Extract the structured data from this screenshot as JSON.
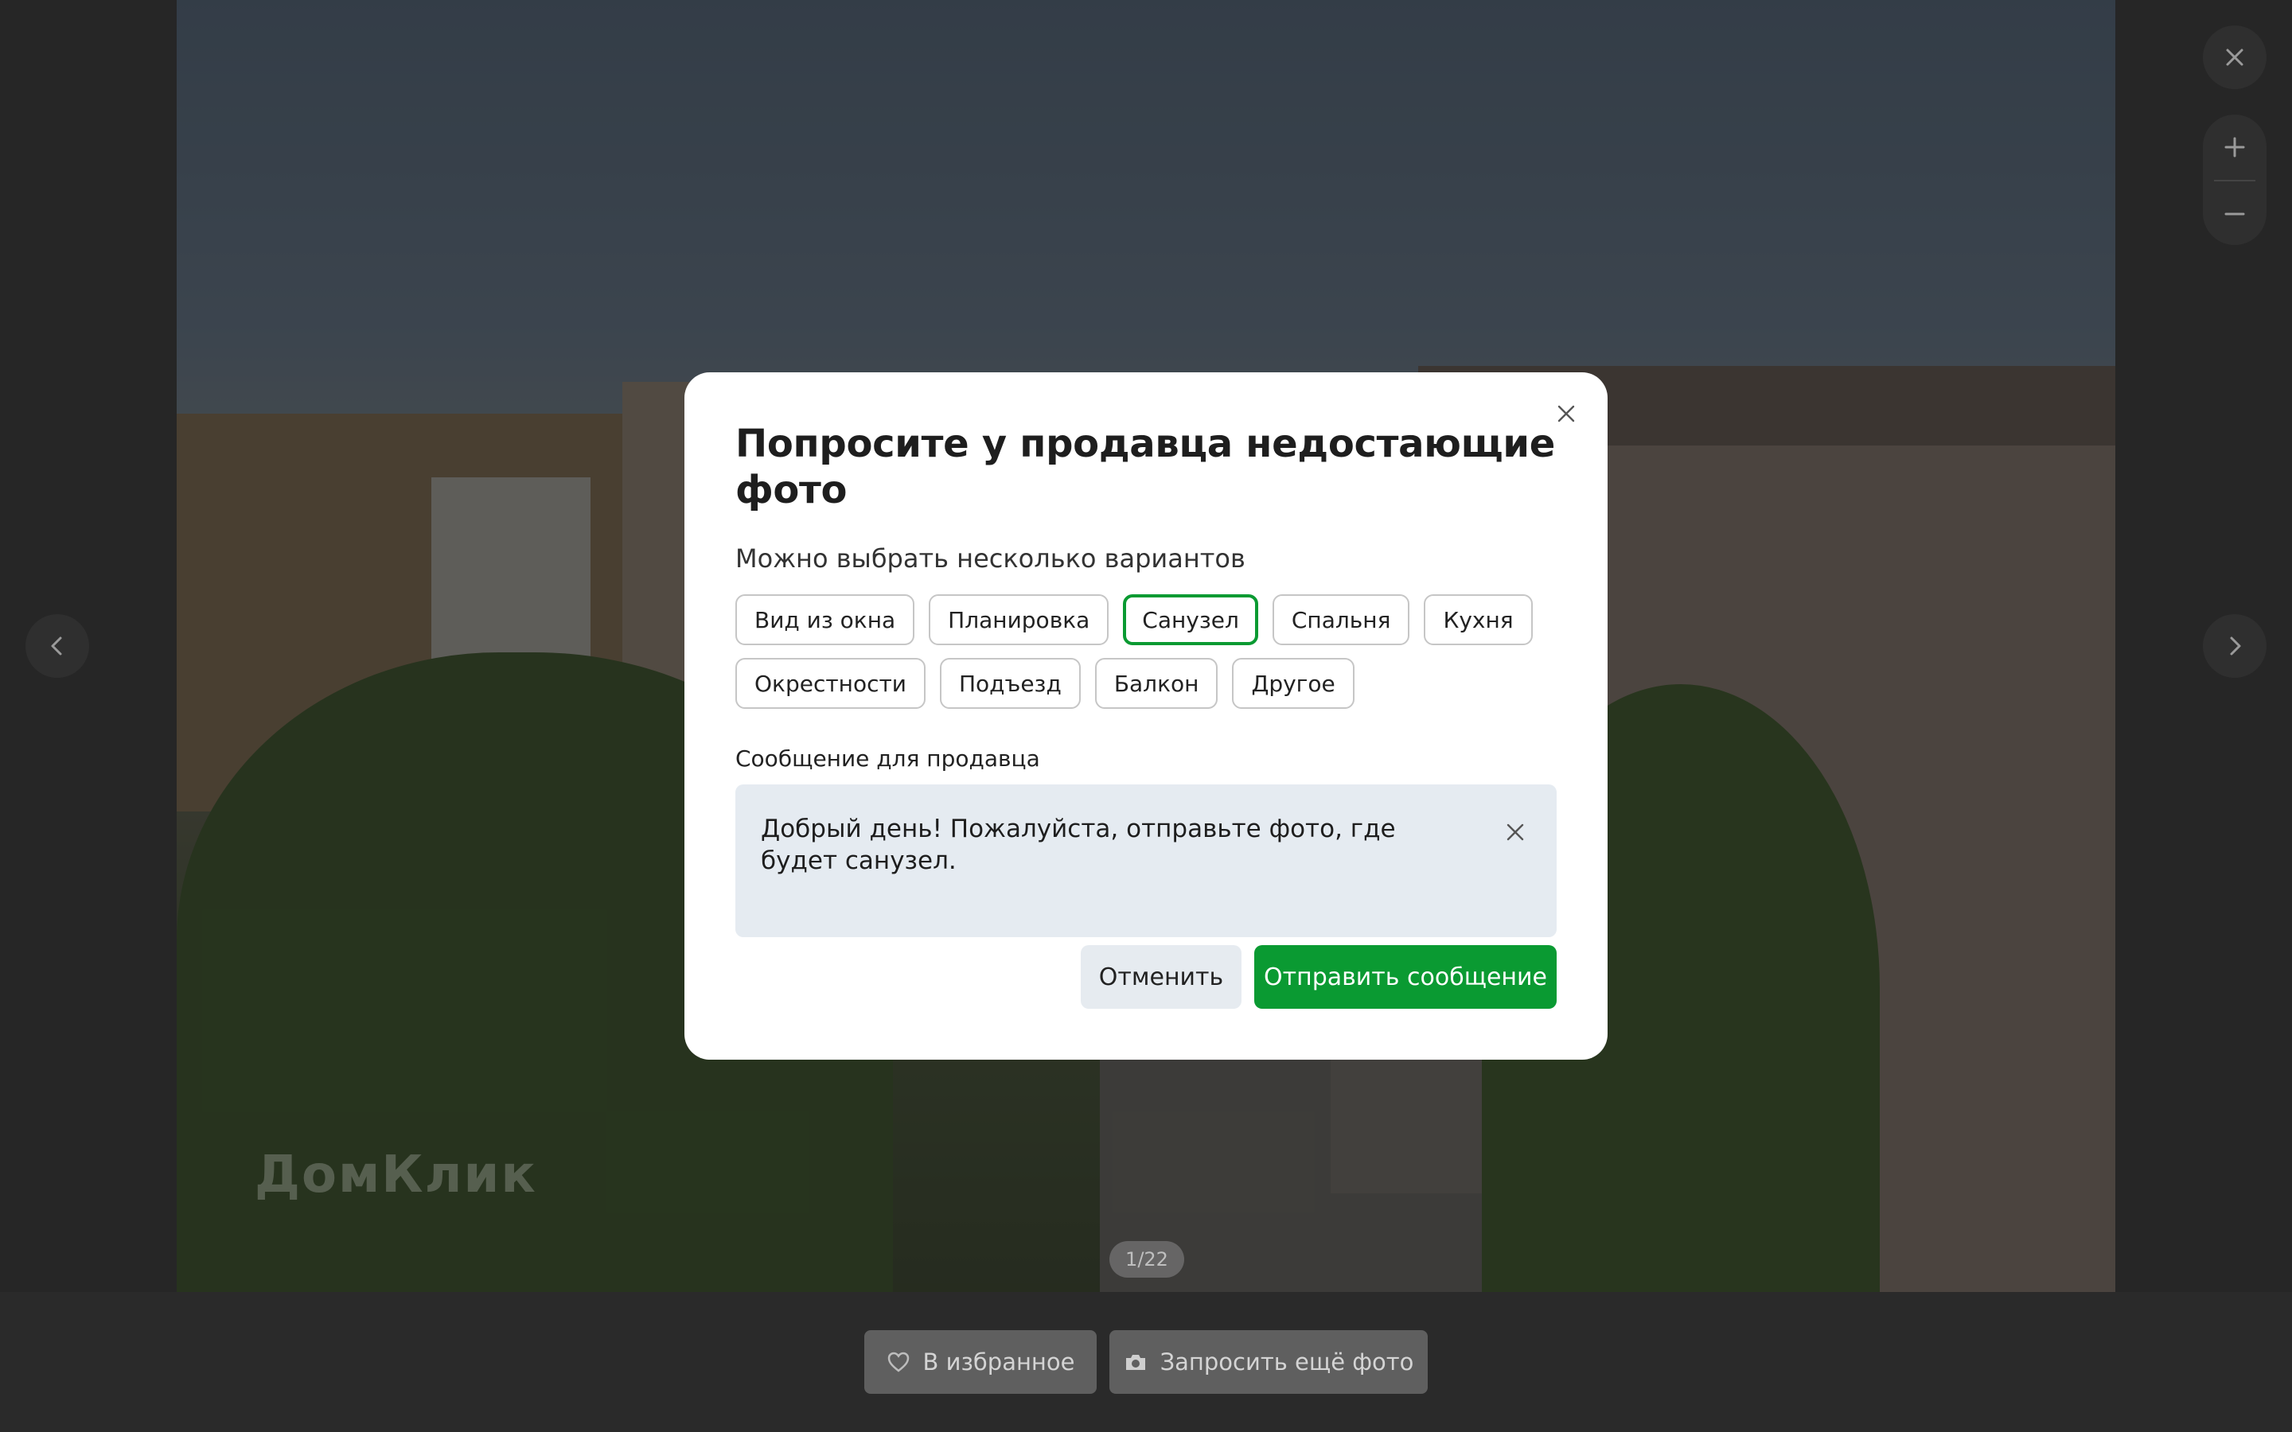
{
  "viewer": {
    "counter": "1/22",
    "watermark": "ДомКлик",
    "close_icon": "close-icon",
    "zoom_in_icon": "plus-icon",
    "zoom_out_icon": "minus-icon",
    "prev_icon": "chevron-left-icon",
    "next_icon": "chevron-right-icon"
  },
  "bottom_bar": {
    "favorite_label": "В избранное",
    "favorite_icon": "heart-icon",
    "request_label": "Запросить ещё фото",
    "request_icon": "camera-icon"
  },
  "modal": {
    "title": "Попросите у продавца недостающие фото",
    "subtitle": "Можно выбрать несколько вариантов",
    "options": [
      {
        "label": "Вид из окна",
        "selected": false
      },
      {
        "label": "Планировка",
        "selected": false
      },
      {
        "label": "Санузел",
        "selected": true
      },
      {
        "label": "Спальня",
        "selected": false
      },
      {
        "label": "Кухня",
        "selected": false
      },
      {
        "label": "Окрестности",
        "selected": false
      },
      {
        "label": "Подъезд",
        "selected": false
      },
      {
        "label": "Балкон",
        "selected": false
      },
      {
        "label": "Другое",
        "selected": false
      }
    ],
    "message_label": "Сообщение для продавца",
    "message_value": "Добрый день! Пожалуйста, отправьте фото, где будет санузел.",
    "cancel_label": "Отменить",
    "submit_label": "Отправить сообщение"
  },
  "colors": {
    "accent": "#0a9a32",
    "textarea_bg": "#e5ebf1",
    "secondary_btn_bg": "#e6ebf0"
  }
}
